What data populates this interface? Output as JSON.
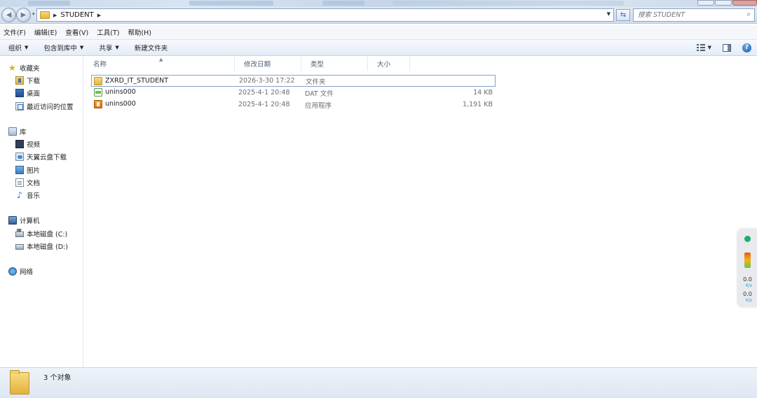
{
  "address": {
    "path_segment": "STUDENT"
  },
  "search": {
    "placeholder": "搜索 STUDENT"
  },
  "menu": [
    "文件(F)",
    "编辑(E)",
    "查看(V)",
    "工具(T)",
    "帮助(H)"
  ],
  "toolbar": {
    "organize": "组织",
    "include_in_library": "包含到库中",
    "share": "共享",
    "new_folder": "新建文件夹"
  },
  "nav": {
    "favorites": "收藏夹",
    "downloads": "下载",
    "desktop": "桌面",
    "recent": "最近访问的位置",
    "libraries": "库",
    "videos": "视频",
    "cloud_download": "天翼云盘下载",
    "pictures": "图片",
    "documents": "文档",
    "music": "音乐",
    "computer": "计算机",
    "drive_c": "本地磁盘 (C:)",
    "drive_d": "本地磁盘 (D:)",
    "network": "网络"
  },
  "columns": {
    "name": "名称",
    "date": "修改日期",
    "type": "类型",
    "size": "大小"
  },
  "files": [
    {
      "name": "ZXRD_IT_STUDENT",
      "date": "2026-3-30 17:22",
      "type": "文件夹",
      "size": "",
      "icon": "folder-icon"
    },
    {
      "name": "unins000",
      "date": "2025-4-1 20:48",
      "type": "DAT 文件",
      "size": "14 KB",
      "icon": "dat-file-icon"
    },
    {
      "name": "unins000",
      "date": "2025-4-1 20:48",
      "type": "应用程序",
      "size": "1,191 KB",
      "icon": "application-icon"
    }
  ],
  "net_widget": {
    "upload": "0.0",
    "download": "0.0",
    "unit": "K/s"
  },
  "status": {
    "item_count": "3 个对象"
  },
  "colors": {
    "accent": "#2f6fb8",
    "selection_border": "#7da2ce",
    "status_green": "#18b26b"
  }
}
